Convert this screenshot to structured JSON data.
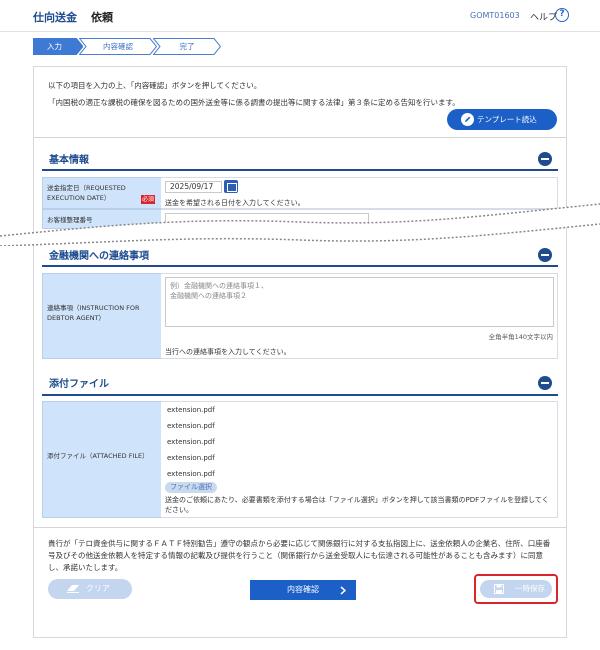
{
  "header": {
    "title": "仕向送金",
    "subtitle": "依頼",
    "screen_code": "GOMT01603",
    "help_label": "ヘルプ",
    "help_icon": "?"
  },
  "steps": [
    {
      "label": "入力",
      "active": true
    },
    {
      "label": "内容確認",
      "active": false
    },
    {
      "label": "完了",
      "active": false
    }
  ],
  "intro": {
    "line1": "以下の項目を入力の上、「内容確認」ボタンを押してください。",
    "line2": "「内国税の適正な課税の確保を図るための国外送金等に係る調書の提出等に関する法律」第３条に定める告知を行います。"
  },
  "template_button": {
    "label": "テンプレート読込",
    "icon": "pencil-icon"
  },
  "basic_info": {
    "title": "基本情報",
    "date_label": "送金指定日（REQUESTED EXECUTION DATE）",
    "required_badge": "必須",
    "date_value": "2025/09/17",
    "date_note": "送金を希望される日付を入力してください。",
    "ref_label": "お客様整理番号"
  },
  "bank_contact": {
    "title": "金融機関への連絡事項",
    "label": "連絡事項（INSTRUCTION FOR DEBTOR AGENT）",
    "placeholder_line1": "例）金融機関への連絡事項１、",
    "placeholder_line2": "金融機関への連絡事項２",
    "char_limit": "全角半角140文字以内",
    "note": "当行への連絡事項を入力してください。"
  },
  "attachments": {
    "title": "添付ファイル",
    "label": "添付ファイル（ATTACHED FILE）",
    "files": [
      "extension.pdf",
      "extension.pdf",
      "extension.pdf",
      "extension.pdf",
      "extension.pdf"
    ],
    "select_button": "ファイル選択",
    "note": "送金のご依頼にあたり、必要書類を添付する場合は「ファイル選択」ボタンを押して該当書類のPDFファイルを登録してください。"
  },
  "disclaimer": "貴行が「テロ資金供与に関するＦＡＴＦ特別勧告」遵守の観点から必要に応じて関係銀行に対する支払指図上に、送金依頼人の企業名、住所、口座番号及びその他送金依頼人を特定する情報の記載及び提供を行うこと（関係銀行から送金受取人にも伝達される可能性があることも含みます）に同意し、承諾いたします。",
  "actions": {
    "clear": "クリア",
    "confirm": "内容確認",
    "save": "一時保存"
  },
  "colors": {
    "brand": "#1e4c8f",
    "accent": "#1b5fc7",
    "highlight": "#d9252b"
  }
}
